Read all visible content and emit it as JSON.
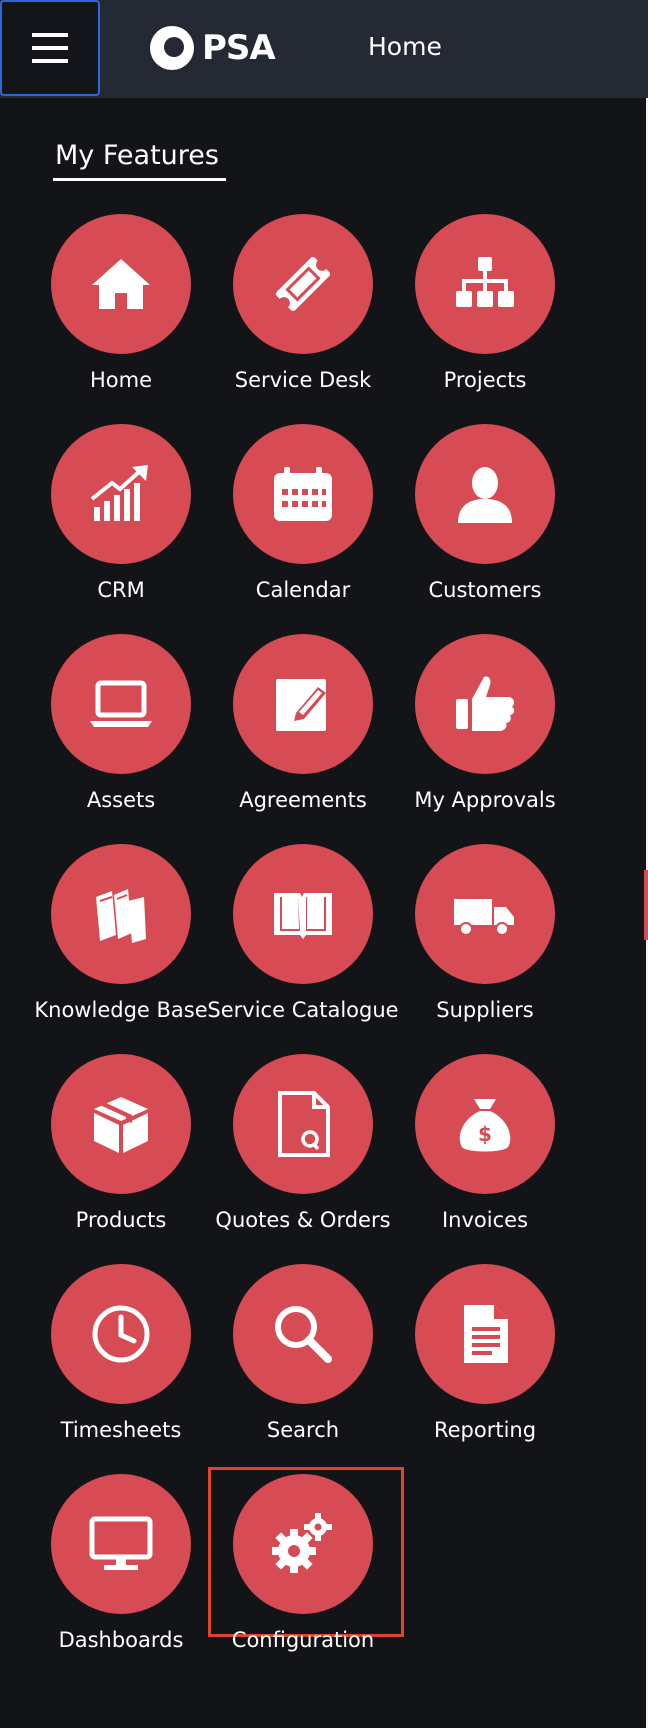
{
  "header": {
    "menu_icon": "hamburger-menu-icon",
    "logo_text": "PSA",
    "page_title": "Home"
  },
  "drawer": {
    "section_title": "My Features",
    "selected_item": "Configuration",
    "items": [
      {
        "label": "Home",
        "icon": "home-icon"
      },
      {
        "label": "Service Desk",
        "icon": "ticket-icon"
      },
      {
        "label": "Projects",
        "icon": "hierarchy-icon"
      },
      {
        "label": "CRM",
        "icon": "growth-chart-icon"
      },
      {
        "label": "Calendar",
        "icon": "calendar-icon"
      },
      {
        "label": "Customers",
        "icon": "user-icon"
      },
      {
        "label": "Assets",
        "icon": "laptop-icon"
      },
      {
        "label": "Agreements",
        "icon": "edit-document-icon"
      },
      {
        "label": "My Approvals",
        "icon": "thumbs-up-icon"
      },
      {
        "label": "Knowledge Base",
        "icon": "books-icon"
      },
      {
        "label": "Service Catalogue",
        "icon": "open-book-icon"
      },
      {
        "label": "Suppliers",
        "icon": "delivery-truck-icon"
      },
      {
        "label": "Products",
        "icon": "package-icon"
      },
      {
        "label": "Quotes & Orders",
        "icon": "quote-document-icon"
      },
      {
        "label": "Invoices",
        "icon": "money-bag-icon"
      },
      {
        "label": "Timesheets",
        "icon": "clock-icon"
      },
      {
        "label": "Search",
        "icon": "search-icon"
      },
      {
        "label": "Reporting",
        "icon": "report-icon"
      },
      {
        "label": "Dashboards",
        "icon": "monitor-icon"
      },
      {
        "label": "Configuration",
        "icon": "gears-icon"
      }
    ]
  },
  "colors": {
    "topbar": "#252934",
    "drawer": "#131418",
    "tile": "#d64b54",
    "selection_outline": "#e1432f",
    "menu_border": "#2e68d8"
  }
}
